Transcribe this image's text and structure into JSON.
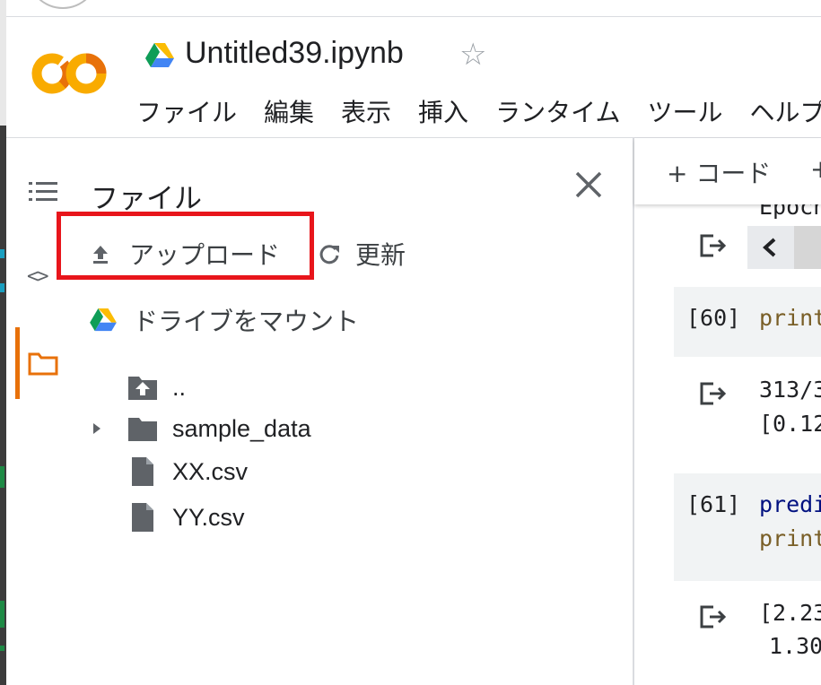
{
  "header": {
    "notebook_title": "Untitled39.ipynb",
    "menu": [
      "ファイル",
      "編集",
      "表示",
      "挿入",
      "ランタイム",
      "ツール",
      "ヘルプ"
    ]
  },
  "file_panel": {
    "title": "ファイル",
    "upload_label": "アップロード",
    "refresh_label": "更新",
    "mount_label": "ドライブをマウント",
    "tree": [
      {
        "label": "..",
        "icon": "parent-folder-icon"
      },
      {
        "label": "sample_data",
        "icon": "folder-icon"
      },
      {
        "label": "XX.csv",
        "icon": "file-icon"
      },
      {
        "label": "YY.csv",
        "icon": "file-icon"
      }
    ]
  },
  "toolbar": {
    "add_code_label": "+ コード",
    "add_text_label": "+"
  },
  "notebook": {
    "cutoff_text": "Epoch",
    "cells": [
      {
        "exec_count": "[60]",
        "code": [
          "print"
        ],
        "output": [
          "313/3",
          "[0.12"
        ]
      },
      {
        "exec_count": "[61]",
        "code": [
          "predi",
          "print"
        ],
        "output": [
          "[2.23",
          "1.30"
        ]
      }
    ]
  },
  "colors": {
    "colab_orange": "#f9ab00",
    "colab_orange_dark": "#e8710a",
    "highlight_red": "#e8151b",
    "sidebar_active": "#e8710a"
  }
}
